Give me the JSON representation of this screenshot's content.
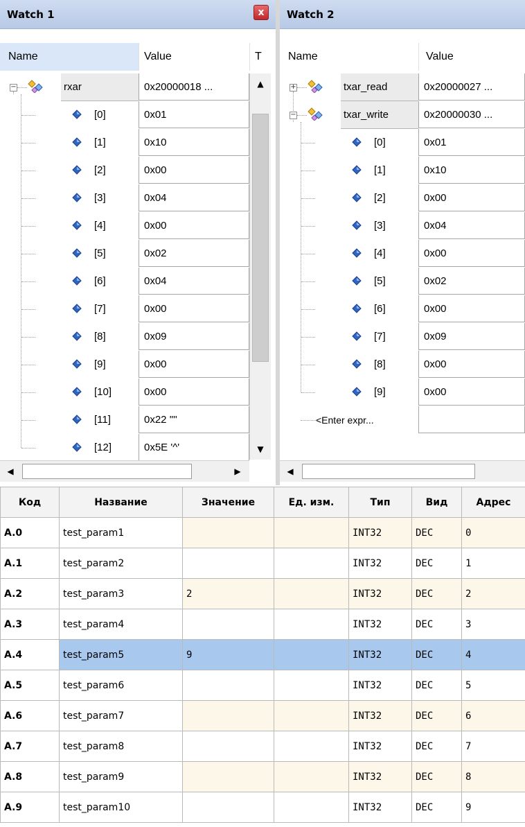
{
  "watch1": {
    "title": "Watch 1",
    "close_label": "x",
    "col_name": "Name",
    "col_value": "Value",
    "col_type": "T",
    "root": {
      "name": "rxar",
      "value": "0x20000018 ...",
      "expander": "−"
    },
    "items": [
      {
        "name": "[0]",
        "value": "0x01"
      },
      {
        "name": "[1]",
        "value": "0x10"
      },
      {
        "name": "[2]",
        "value": "0x00"
      },
      {
        "name": "[3]",
        "value": "0x04"
      },
      {
        "name": "[4]",
        "value": "0x00"
      },
      {
        "name": "[5]",
        "value": "0x02"
      },
      {
        "name": "[6]",
        "value": "0x04"
      },
      {
        "name": "[7]",
        "value": "0x00"
      },
      {
        "name": "[8]",
        "value": "0x09"
      },
      {
        "name": "[9]",
        "value": "0x00"
      },
      {
        "name": "[10]",
        "value": "0x00"
      },
      {
        "name": "[11]",
        "value": "0x22 '\"'"
      },
      {
        "name": "[12]",
        "value": "0x5E '^'"
      }
    ],
    "scroll_up": "▲",
    "scroll_down": "▼",
    "scroll_left": "◀",
    "scroll_right": "▶"
  },
  "watch2": {
    "title": "Watch 2",
    "col_name": "Name",
    "col_value": "Value",
    "roots": [
      {
        "name": "txar_read",
        "value": "0x20000027 ...",
        "expander": "+"
      },
      {
        "name": "txar_write",
        "value": "0x20000030 ...",
        "expander": "−"
      }
    ],
    "items": [
      {
        "name": "[0]",
        "value": "0x01"
      },
      {
        "name": "[1]",
        "value": "0x10"
      },
      {
        "name": "[2]",
        "value": "0x00"
      },
      {
        "name": "[3]",
        "value": "0x04"
      },
      {
        "name": "[4]",
        "value": "0x00"
      },
      {
        "name": "[5]",
        "value": "0x02"
      },
      {
        "name": "[6]",
        "value": "0x00"
      },
      {
        "name": "[7]",
        "value": "0x09"
      },
      {
        "name": "[8]",
        "value": "0x00"
      },
      {
        "name": "[9]",
        "value": "0x00"
      }
    ],
    "enter_expr": "<Enter expr...",
    "scroll_left": "◀"
  },
  "params": {
    "headers": [
      "Код",
      "Название",
      "Значение",
      "Ед. изм.",
      "Тип",
      "Вид",
      "Адрес"
    ],
    "selected_row": 4,
    "rows": [
      [
        "A.0",
        "test_param1",
        "",
        "",
        "INT32",
        "DEC",
        "0"
      ],
      [
        "A.1",
        "test_param2",
        "",
        "",
        "INT32",
        "DEC",
        "1"
      ],
      [
        "A.2",
        "test_param3",
        "2",
        "",
        "INT32",
        "DEC",
        "2"
      ],
      [
        "A.3",
        "test_param4",
        "",
        "",
        "INT32",
        "DEC",
        "3"
      ],
      [
        "A.4",
        "test_param5",
        "9",
        "",
        "INT32",
        "DEC",
        "4"
      ],
      [
        "A.5",
        "test_param6",
        "",
        "",
        "INT32",
        "DEC",
        "5"
      ],
      [
        "A.6",
        "test_param7",
        "",
        "",
        "INT32",
        "DEC",
        "6"
      ],
      [
        "A.7",
        "test_param8",
        "",
        "",
        "INT32",
        "DEC",
        "7"
      ],
      [
        "A.8",
        "test_param9",
        "",
        "",
        "INT32",
        "DEC",
        "8"
      ],
      [
        "A.9",
        "test_param10",
        "",
        "",
        "INT32",
        "DEC",
        "9"
      ]
    ]
  },
  "colors": {
    "title_bar": "#c4d4ee",
    "selected_row": "#a9c8ee",
    "odd_row": "#fdf7ea",
    "close_button": "#d9393b"
  }
}
